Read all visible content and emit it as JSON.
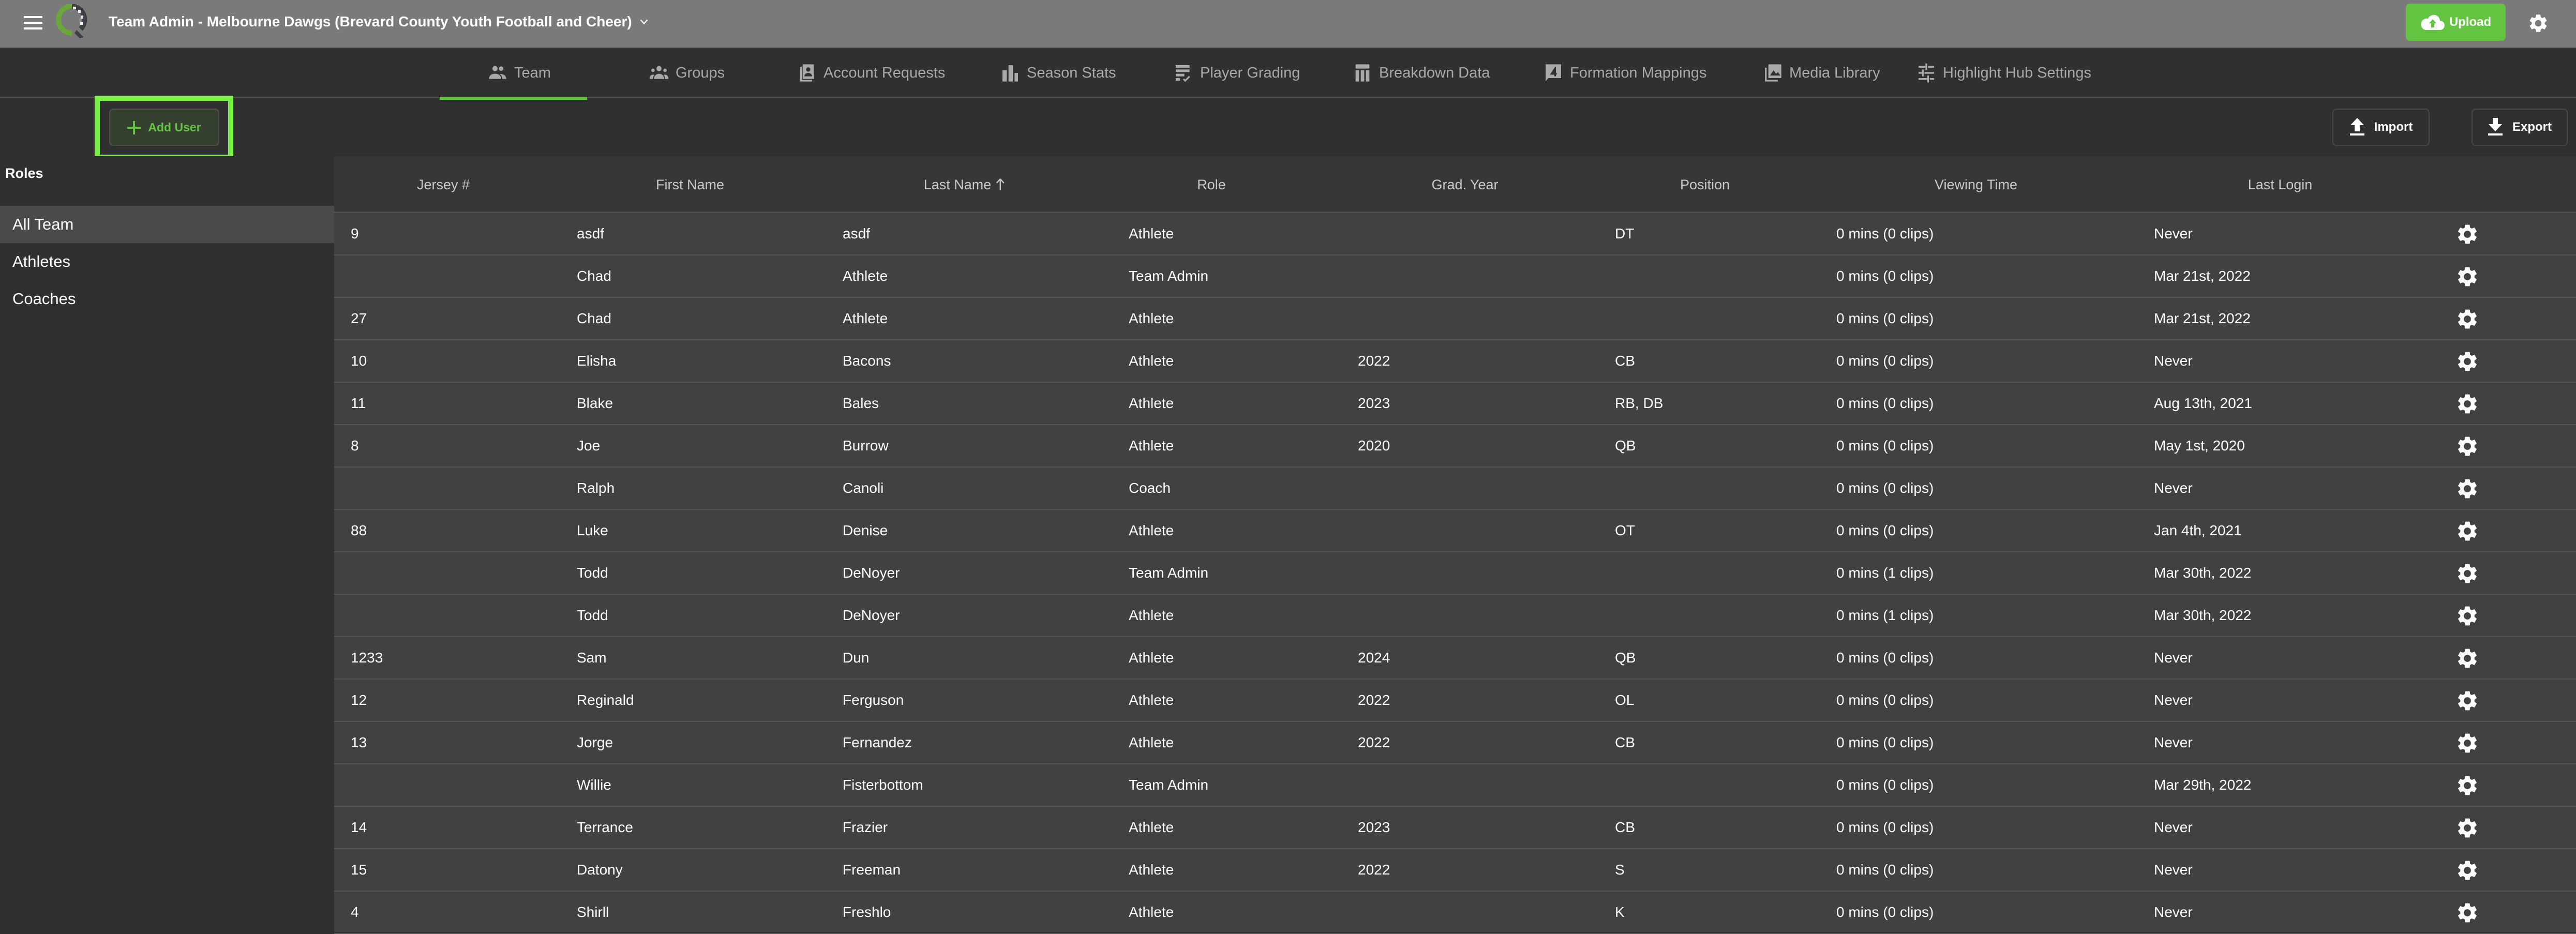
{
  "header": {
    "app_title": "Team Admin - Melbourne Dawgs (Brevard County Youth Football and Cheer)",
    "upload_label": "Upload",
    "colors": {
      "topbar": "#7a7a7a",
      "accent_green": "#62c440",
      "highlight_green": "#78f046"
    }
  },
  "tabs": [
    {
      "label": "Team",
      "icon": "people-icon",
      "active": true
    },
    {
      "label": "Groups",
      "icon": "groups-icon",
      "active": false
    },
    {
      "label": "Account Requests",
      "icon": "contact-book-icon",
      "active": false
    },
    {
      "label": "Season Stats",
      "icon": "bar-chart-icon",
      "active": false
    },
    {
      "label": "Player Grading",
      "icon": "checklist-icon",
      "active": false
    },
    {
      "label": "Breakdown Data",
      "icon": "table-icon",
      "active": false
    },
    {
      "label": "Formation Mappings",
      "icon": "formation-icon",
      "active": false
    },
    {
      "label": "Media Library",
      "icon": "image-library-icon",
      "active": false
    },
    {
      "label": "Highlight Hub Settings",
      "icon": "sliders-icon",
      "active": false
    }
  ],
  "toolbar": {
    "add_user_label": "Add User",
    "import_label": "Import",
    "export_label": "Export"
  },
  "sidebar": {
    "title": "Roles",
    "items": [
      {
        "label": "All Team",
        "selected": true
      },
      {
        "label": "Athletes",
        "selected": false
      },
      {
        "label": "Coaches",
        "selected": false
      }
    ]
  },
  "table": {
    "columns": [
      "Jersey #",
      "First Name",
      "Last Name",
      "Role",
      "Grad. Year",
      "Position",
      "Viewing Time",
      "Last Login"
    ],
    "sorted_column": "Last Name",
    "sort_direction": "ascending",
    "rows": [
      {
        "jersey": "9",
        "first": "asdf",
        "last": "asdf",
        "role": "Athlete",
        "grad": "",
        "position": "DT",
        "viewing": "0 mins (0 clips)",
        "login": "Never"
      },
      {
        "jersey": "",
        "first": "Chad",
        "last": "Athlete",
        "role": "Team Admin",
        "grad": "",
        "position": "",
        "viewing": "0 mins (0 clips)",
        "login": "Mar 21st, 2022"
      },
      {
        "jersey": "27",
        "first": "Chad",
        "last": "Athlete",
        "role": "Athlete",
        "grad": "",
        "position": "",
        "viewing": "0 mins (0 clips)",
        "login": "Mar 21st, 2022"
      },
      {
        "jersey": "10",
        "first": "Elisha",
        "last": "Bacons",
        "role": "Athlete",
        "grad": "2022",
        "position": "CB",
        "viewing": "0 mins (0 clips)",
        "login": "Never"
      },
      {
        "jersey": "11",
        "first": "Blake",
        "last": "Bales",
        "role": "Athlete",
        "grad": "2023",
        "position": "RB, DB",
        "viewing": "0 mins (0 clips)",
        "login": "Aug 13th, 2021"
      },
      {
        "jersey": "8",
        "first": "Joe",
        "last": "Burrow",
        "role": "Athlete",
        "grad": "2020",
        "position": "QB",
        "viewing": "0 mins (0 clips)",
        "login": "May 1st, 2020"
      },
      {
        "jersey": "",
        "first": "Ralph",
        "last": "Canoli",
        "role": "Coach",
        "grad": "",
        "position": "",
        "viewing": "0 mins (0 clips)",
        "login": "Never"
      },
      {
        "jersey": "88",
        "first": "Luke",
        "last": "Denise",
        "role": "Athlete",
        "grad": "",
        "position": "OT",
        "viewing": "0 mins (0 clips)",
        "login": "Jan 4th, 2021"
      },
      {
        "jersey": "",
        "first": "Todd",
        "last": "DeNoyer",
        "role": "Team Admin",
        "grad": "",
        "position": "",
        "viewing": "0 mins (1 clips)",
        "login": "Mar 30th, 2022"
      },
      {
        "jersey": "",
        "first": "Todd",
        "last": "DeNoyer",
        "role": "Athlete",
        "grad": "",
        "position": "",
        "viewing": "0 mins (1 clips)",
        "login": "Mar 30th, 2022"
      },
      {
        "jersey": "1233",
        "first": "Sam",
        "last": "Dun",
        "role": "Athlete",
        "grad": "2024",
        "position": "QB",
        "viewing": "0 mins (0 clips)",
        "login": "Never"
      },
      {
        "jersey": "12",
        "first": "Reginald",
        "last": "Ferguson",
        "role": "Athlete",
        "grad": "2022",
        "position": "OL",
        "viewing": "0 mins (0 clips)",
        "login": "Never"
      },
      {
        "jersey": "13",
        "first": "Jorge",
        "last": "Fernandez",
        "role": "Athlete",
        "grad": "2022",
        "position": "CB",
        "viewing": "0 mins (0 clips)",
        "login": "Never"
      },
      {
        "jersey": "",
        "first": "Willie",
        "last": "Fisterbottom",
        "role": "Team Admin",
        "grad": "",
        "position": "",
        "viewing": "0 mins (0 clips)",
        "login": "Mar 29th, 2022"
      },
      {
        "jersey": "14",
        "first": "Terrance",
        "last": "Frazier",
        "role": "Athlete",
        "grad": "2023",
        "position": "CB",
        "viewing": "0 mins (0 clips)",
        "login": "Never"
      },
      {
        "jersey": "15",
        "first": "Datony",
        "last": "Freeman",
        "role": "Athlete",
        "grad": "2022",
        "position": "S",
        "viewing": "0 mins (0 clips)",
        "login": "Never"
      },
      {
        "jersey": "4",
        "first": "Shirll",
        "last": "Freshlo",
        "role": "Athlete",
        "grad": "",
        "position": "K",
        "viewing": "0 mins (0 clips)",
        "login": "Never"
      }
    ]
  }
}
